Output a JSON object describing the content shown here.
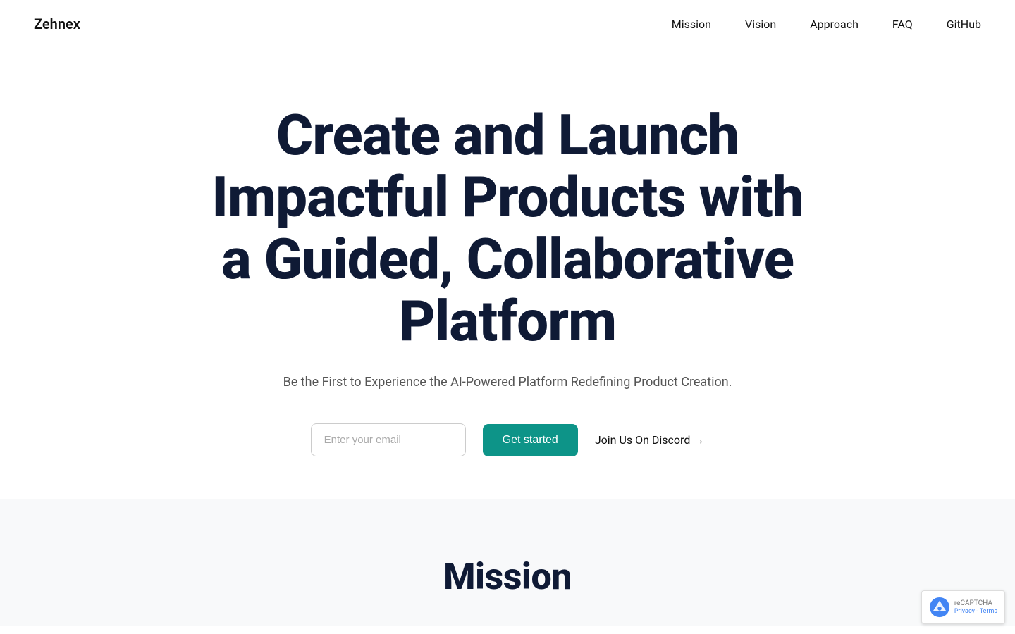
{
  "brand": {
    "name": "Zehnex"
  },
  "navbar": {
    "links": [
      {
        "label": "Mission",
        "href": "#mission"
      },
      {
        "label": "Vision",
        "href": "#vision"
      },
      {
        "label": "Approach",
        "href": "#approach"
      },
      {
        "label": "FAQ",
        "href": "#faq"
      },
      {
        "label": "GitHub",
        "href": "#github"
      }
    ]
  },
  "hero": {
    "title": "Create and Launch Impactful Products with a Guided, Collaborative Platform",
    "subtitle": "Be the First to Experience the AI-Powered Platform Redefining Product Creation.",
    "email_placeholder": "Enter your email",
    "cta_label": "Get started",
    "discord_label": "Join Us On Discord →"
  },
  "mission": {
    "title": "Mission"
  },
  "recaptcha": {
    "label": "reCAPTCHA",
    "privacy": "Privacy",
    "terms": "Terms"
  }
}
